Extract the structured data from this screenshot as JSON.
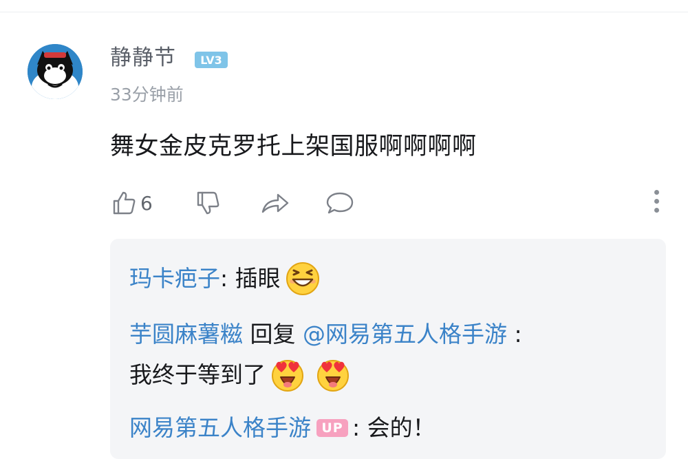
{
  "comment": {
    "username": "静静节",
    "level": "LV3",
    "time": "33分钟前",
    "text": "舞女金皮克罗托上架国服啊啊啊啊",
    "likes": "6",
    "colors": {
      "username": "#5b6069",
      "link": "#3b83c8",
      "level_badge": "#7fc4e8",
      "up_badge": "#f7a1bf"
    }
  },
  "replies": [
    {
      "user": "玛卡疤子",
      "sep": ": ",
      "text": "插眼",
      "emojis": [
        "grinning-squint-emoji"
      ]
    },
    {
      "user": "芋圆麻薯糍",
      "reply_word": " 回复 ",
      "mention": "@网易第五人格手游",
      "sep": " :",
      "text": "我终于等到了",
      "emojis": [
        "heart-eyes-emoji",
        "heart-eyes-emoji"
      ]
    },
    {
      "user": "网易第五人格手游",
      "badge": "UP",
      "sep": ": ",
      "text": "会的！"
    }
  ]
}
